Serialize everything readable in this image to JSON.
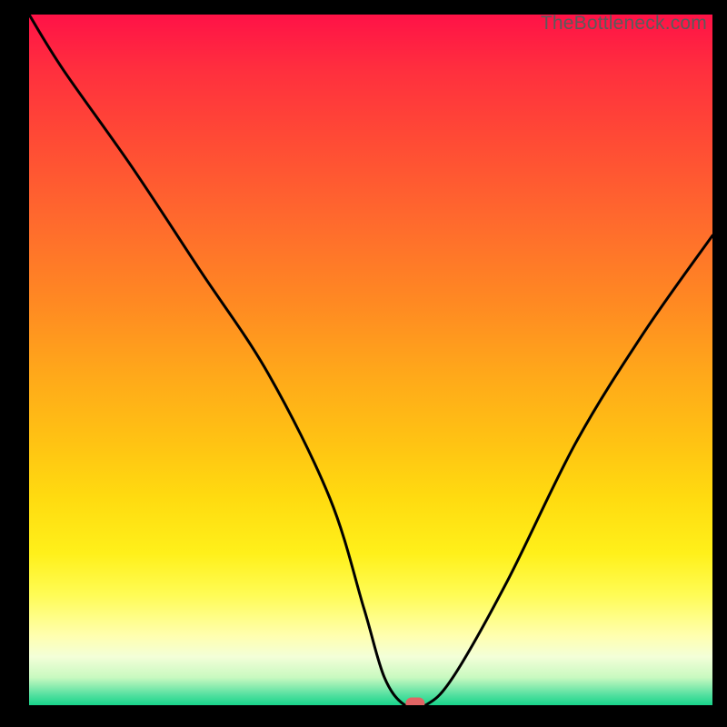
{
  "watermark": "TheBottleneck.com",
  "chart_data": {
    "type": "line",
    "title": "",
    "xlabel": "",
    "ylabel": "",
    "xlim": [
      0,
      100
    ],
    "ylim": [
      0,
      100
    ],
    "x": [
      0,
      5,
      15,
      25,
      35,
      44,
      49,
      52,
      55,
      58,
      62,
      70,
      80,
      90,
      100
    ],
    "values": [
      100,
      92,
      78,
      63,
      48,
      30,
      14,
      4,
      0,
      0,
      4,
      18,
      38,
      54,
      68
    ],
    "marker": {
      "x": 56.5,
      "y": 0
    },
    "series": [
      {
        "name": "bottleneck-curve",
        "x": [
          0,
          5,
          15,
          25,
          35,
          44,
          49,
          52,
          55,
          58,
          62,
          70,
          80,
          90,
          100
        ],
        "values": [
          100,
          92,
          78,
          63,
          48,
          30,
          14,
          4,
          0,
          0,
          4,
          18,
          38,
          54,
          68
        ]
      }
    ]
  }
}
